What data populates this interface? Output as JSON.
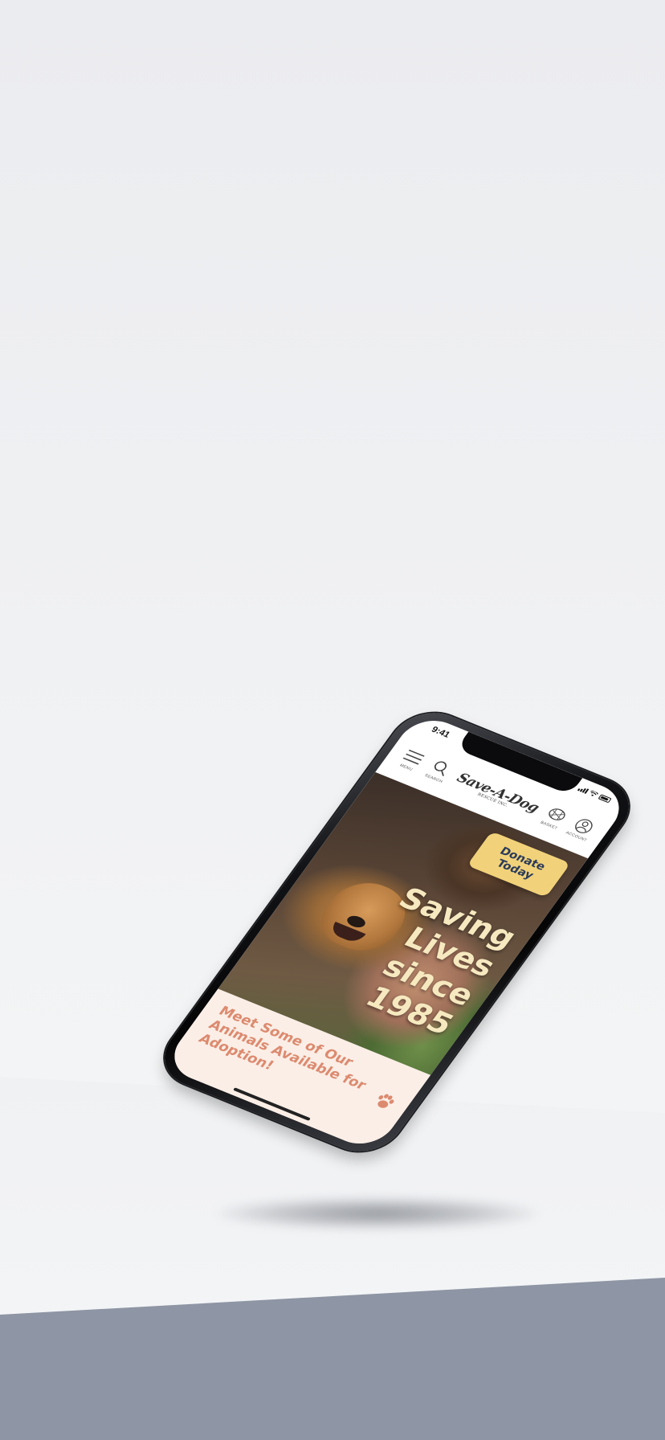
{
  "status_bar": {
    "time": "9:41"
  },
  "header": {
    "menu_label": "MENU",
    "search_label": "SEARCH",
    "logo_text": "Save-A-Dog",
    "logo_subtext": "RESCUE INC.",
    "basket_label": "BASKET",
    "account_label": "ACCOUNT"
  },
  "hero": {
    "donate_label": "Donate\nToday",
    "headline": "Saving\nLives\nsince\n1985"
  },
  "adoption": {
    "title": "Meet Some of Our Animals Available for Adoption!"
  },
  "colors": {
    "donate_bg": "#f1d27a",
    "donate_text": "#2a3a5a",
    "headline": "#f6e9c0",
    "adoption_bg": "#fbeee6",
    "adoption_text": "#dc8a6f",
    "base_band": "#8e95a4"
  }
}
